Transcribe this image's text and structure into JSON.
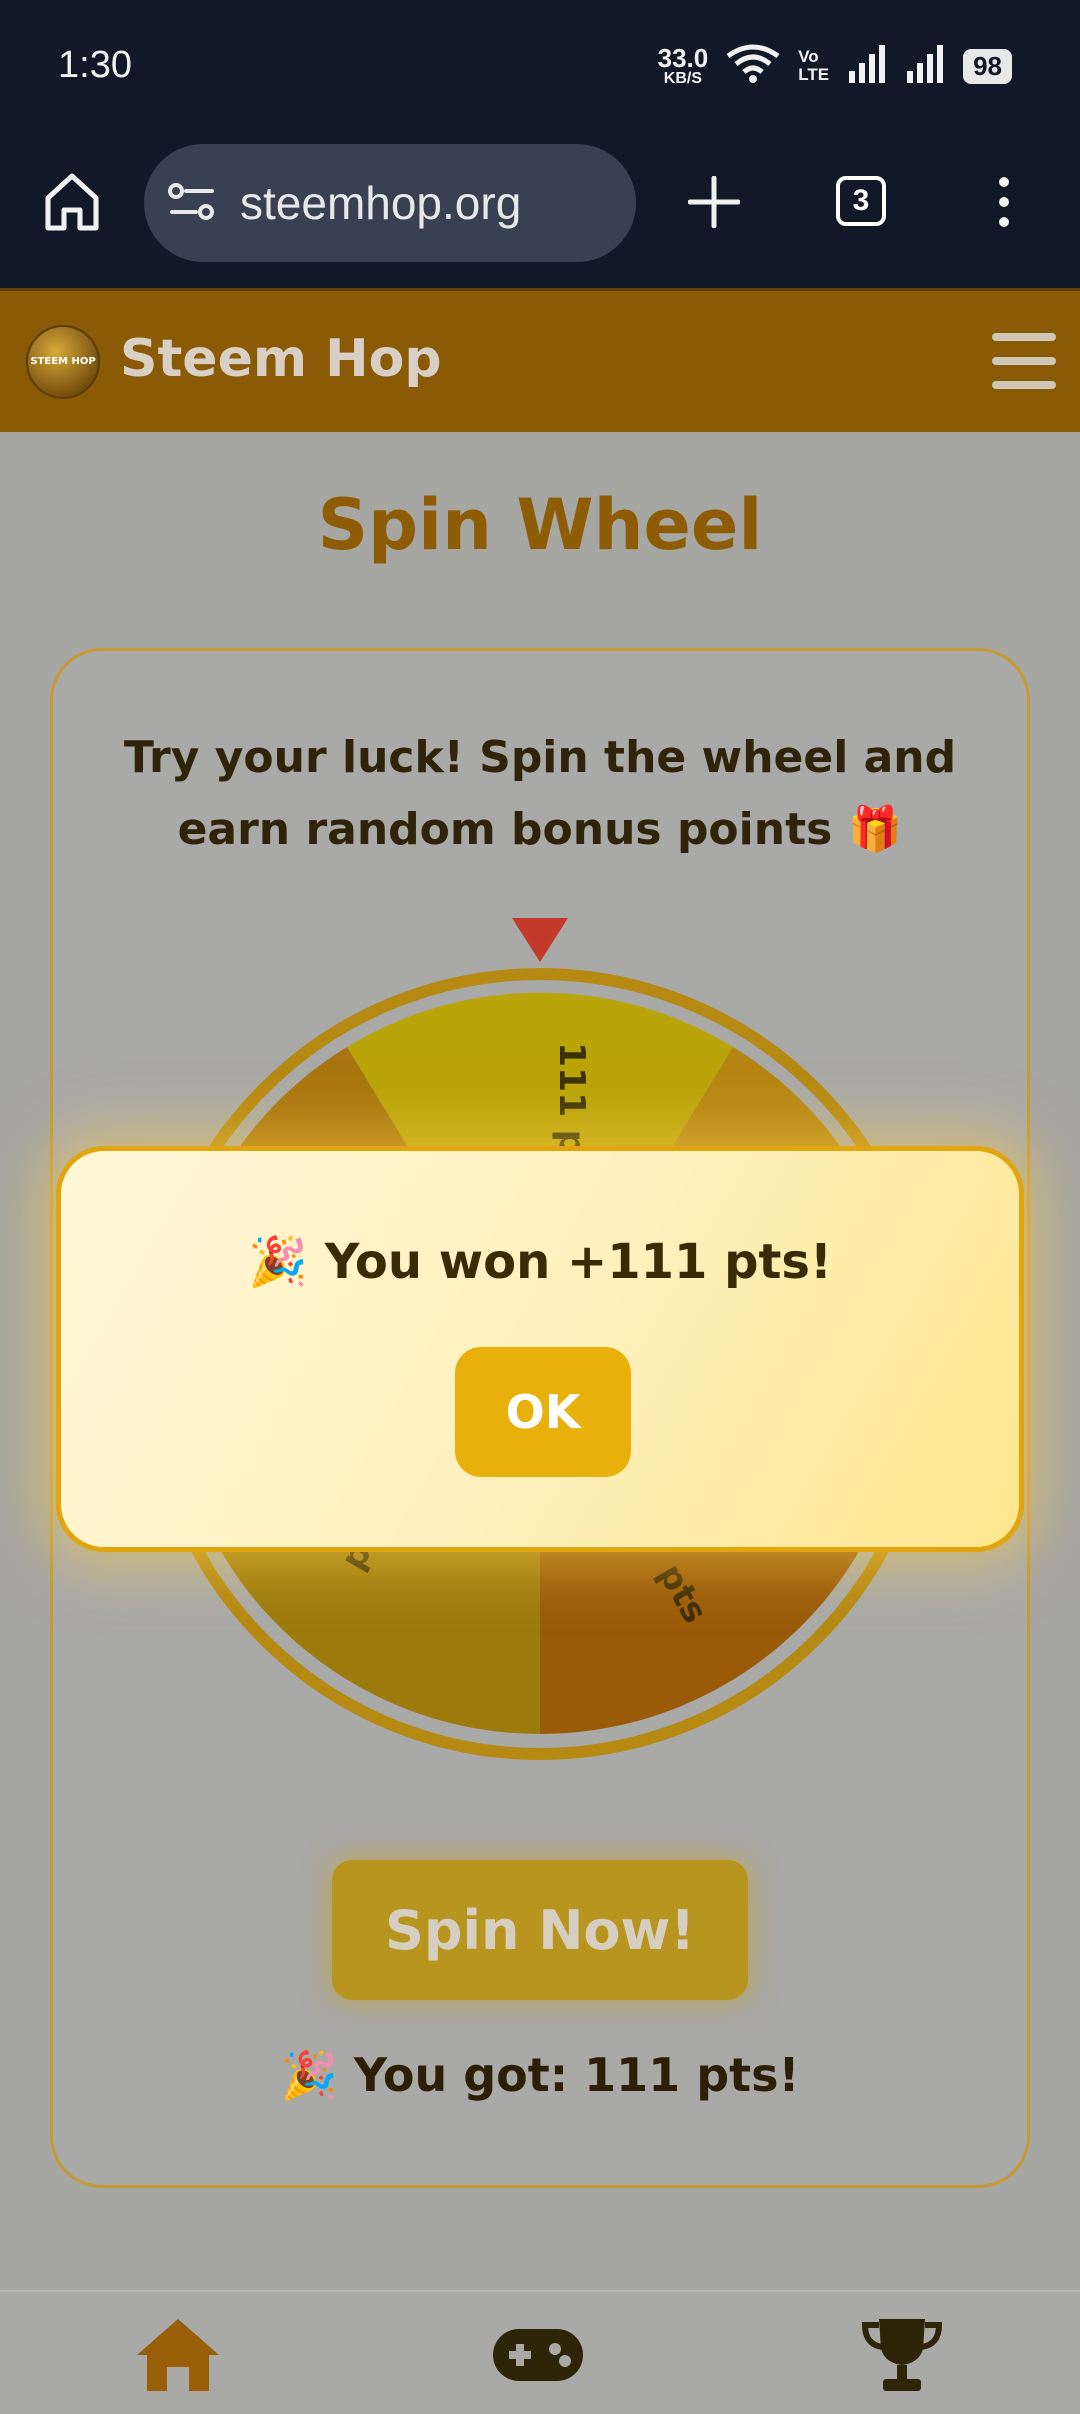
{
  "status_bar": {
    "time": "1:30",
    "net_speed_value": "33.0",
    "net_speed_unit": "KB/S",
    "volte_top": "Vo",
    "volte_bottom": "LTE",
    "battery": "98"
  },
  "browser": {
    "url": "steemhop.org",
    "tab_count": "3"
  },
  "site": {
    "logo_text": "STEEM HOP",
    "title": "Steem Hop"
  },
  "page": {
    "title": "Spin Wheel",
    "description_line1": "Try your luck! Spin the wheel and",
    "description_line2": "earn random bonus points 🎁",
    "wheel_labels": {
      "top": "111 pts",
      "bottom_left": "pts",
      "bottom_right": "7 pts"
    },
    "spin_button": "Spin Now!",
    "result_emoji": "🎉",
    "result_text": "You got: 111 pts!"
  },
  "modal": {
    "emoji": "🎉",
    "message": "You won +111 pts!",
    "ok_label": "OK"
  },
  "bottom_nav": {
    "items": [
      {
        "icon": "home-icon"
      },
      {
        "icon": "gamepad-icon"
      },
      {
        "icon": "trophy-icon"
      }
    ]
  },
  "colors": {
    "header_bg": "#8a5a07",
    "accent": "#e8b00b",
    "title": "#8f5c06"
  }
}
